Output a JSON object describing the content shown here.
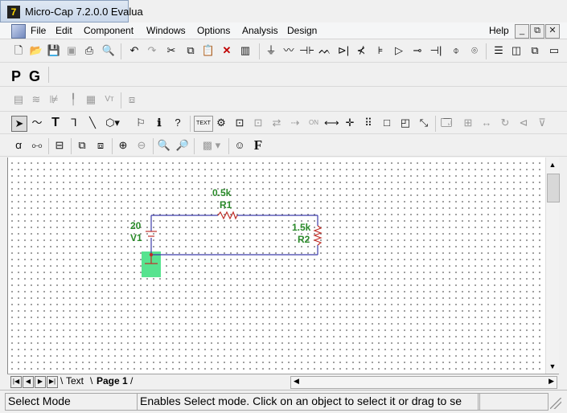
{
  "window": {
    "title": "Micro-Cap 7.2.0.0 Evalua"
  },
  "menu": {
    "items": [
      "File",
      "Edit",
      "Component",
      "Windows",
      "Options",
      "Analysis",
      "Design"
    ],
    "help": "Help",
    "win_buttons": {
      "minimize": "_",
      "restore": "⧉",
      "close": "✕"
    }
  },
  "toolbar2": {
    "p_label": "P",
    "g_label": "G"
  },
  "toolbar4": {
    "text_label": "TEXT",
    "on_label": "ON",
    "f_label": "F"
  },
  "schematic": {
    "r1": {
      "value": "0.5k",
      "name": "R1"
    },
    "r2": {
      "value": "1.5k",
      "name": "R2"
    },
    "v1": {
      "value": "20",
      "name": "V1"
    },
    "color": "#2a8a2a",
    "wire_color": "#3c3caa",
    "highlight": "#57e38f"
  },
  "tabs": {
    "text_tab": "Text",
    "page_tab": "Page 1"
  },
  "status": {
    "mode": "Select Mode",
    "hint": "Enables Select mode. Click on an object to select it or drag to se"
  }
}
